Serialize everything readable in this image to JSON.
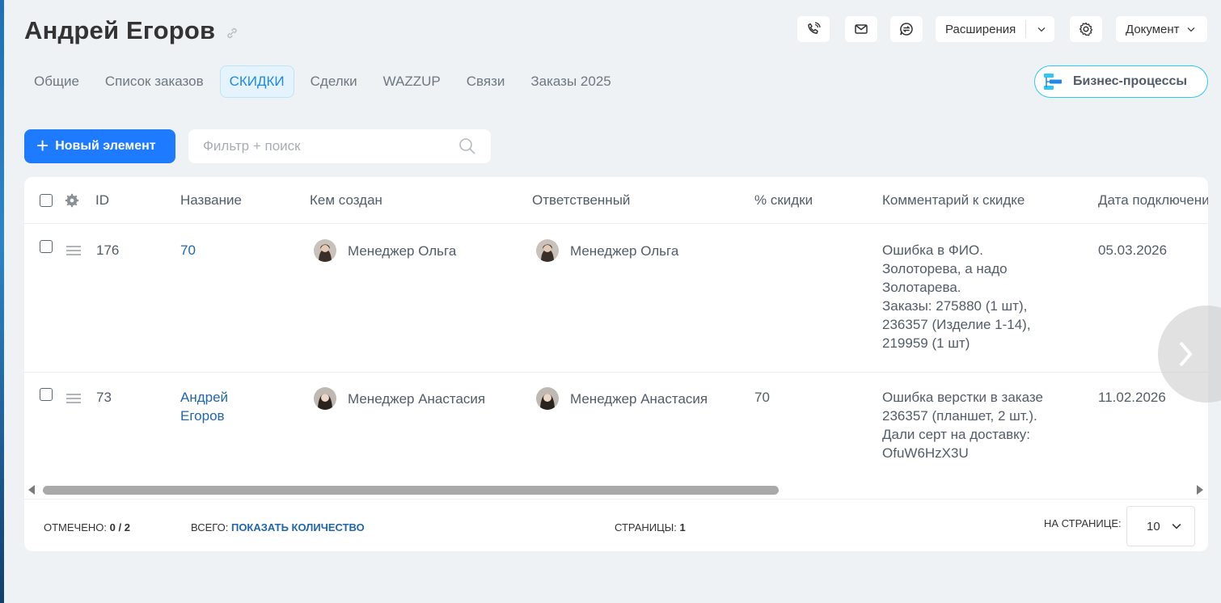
{
  "header": {
    "title": "Андрей Егоров"
  },
  "toolbar": {
    "extensions_label": "Расширения",
    "document_label": "Документ"
  },
  "tabs": [
    {
      "label": "Общие",
      "active": false
    },
    {
      "label": "Список заказов",
      "active": false
    },
    {
      "label": "СКИДКИ",
      "active": true
    },
    {
      "label": "Сделки",
      "active": false
    },
    {
      "label": "WAZZUP",
      "active": false
    },
    {
      "label": "Связи",
      "active": false
    },
    {
      "label": "Заказы 2025",
      "active": false
    }
  ],
  "business_processes_label": "Бизнес-процессы",
  "actions": {
    "new_element_label": "Новый элемент",
    "search_placeholder": "Фильтр + поиск"
  },
  "table": {
    "columns": {
      "id": "ID",
      "name": "Название",
      "created_by": "Кем создан",
      "responsible": "Ответственный",
      "discount": "% скидки",
      "comment": "Комментарий к скидке",
      "date": "Дата подключени"
    },
    "rows": [
      {
        "id": "176",
        "name_lines": [
          "70"
        ],
        "created_by": "Менеджер Ольга",
        "responsible": "Менеджер Ольга",
        "discount": "",
        "comment_lines": [
          "Ошибка в ФИО.",
          "Золоторева, а надо",
          "Золотарева.",
          "Заказы: 275880 (1 шт),",
          "236357 (Изделие 1-14),",
          "219959 (1 шт)"
        ],
        "date": "05.03.2026"
      },
      {
        "id": "73",
        "name_lines": [
          "Андрей",
          "Егоров"
        ],
        "created_by": "Менеджер Анастасия",
        "responsible": "Менеджер Анастасия",
        "discount": "70",
        "comment_lines": [
          "Ошибка верстки в заказе",
          "236357 (планшет, 2 шт.).",
          "Дали серт на доставку:",
          "OfuW6HzX3U"
        ],
        "date": "11.02.2026"
      }
    ]
  },
  "footer": {
    "selected_label": "ОТМЕЧЕНО:",
    "selected_value": "0 / 2",
    "total_label": "ВСЕГО:",
    "total_link": "ПОКАЗАТЬ КОЛИЧЕСТВО",
    "pages_label": "СТРАНИЦЫ:",
    "pages_value": "1",
    "per_page_label": "НА СТРАНИЦЕ:",
    "per_page_value": "10"
  },
  "colors": {
    "accent": "#1e7bff",
    "link": "#2067b0",
    "active_tab": "#1e88e5",
    "bp_border": "#2fc6f6"
  }
}
